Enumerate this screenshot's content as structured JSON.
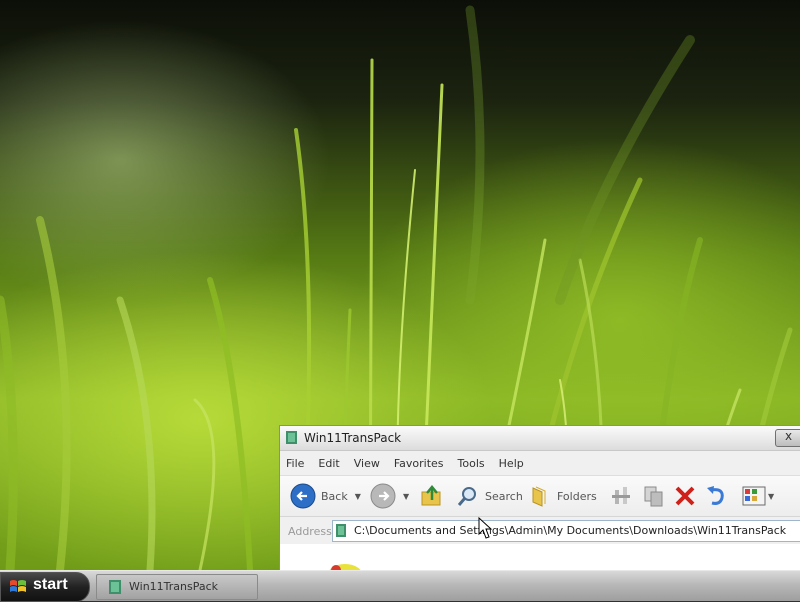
{
  "window": {
    "title": "Win11TransPack",
    "close_glyph": "x"
  },
  "menu": [
    "File",
    "Edit",
    "View",
    "Favorites",
    "Tools",
    "Help"
  ],
  "toolbar": {
    "back_label": "Back",
    "search_label": "Search",
    "folders_label": "Folders",
    "icons": [
      "back-icon",
      "forward-icon",
      "up-folder-icon",
      "search-icon",
      "folders-icon",
      "move-to-icon",
      "copy-to-icon",
      "delete-icon",
      "undo-icon",
      "views-icon"
    ]
  },
  "address": {
    "label": "Address",
    "value": "C:\\Documents and Settings\\Admin\\My Documents\\Downloads\\Win11TransPack"
  },
  "taskbar": {
    "start_label": "start",
    "task_label": "Win11TransPack"
  },
  "colors": {
    "accent_back": "#2d6fc6",
    "delete_red": "#d0201a",
    "undo_blue": "#3a7ad6",
    "folder_yellow": "#e8c44a"
  }
}
